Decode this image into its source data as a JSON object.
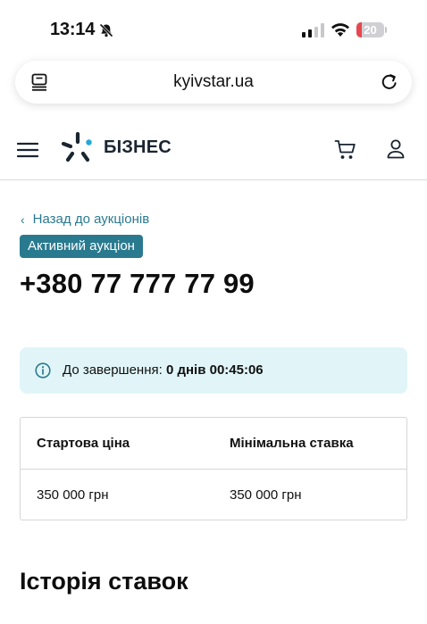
{
  "status_bar": {
    "time": "13:14",
    "battery_level": "20",
    "battery_fraction": 0.2,
    "icons": [
      "bell-slash-icon",
      "signal-icon",
      "wifi-icon",
      "battery-icon"
    ]
  },
  "browser": {
    "url": "kyivstar.ua",
    "icons": [
      "tabs-icon",
      "reload-icon"
    ]
  },
  "header": {
    "logo_text": "БІЗНЕС",
    "icons": [
      "menu-icon",
      "kyivstar-star-logo",
      "cart-icon",
      "user-icon"
    ]
  },
  "page": {
    "back_link": "Назад до аукціонів",
    "status_badge": "Активний аукціон",
    "phone_number": "+380 77 777 77 99",
    "timer": {
      "label": "До завершення:",
      "value": "0 днів 00:45:06"
    },
    "table": {
      "headers": [
        "Стартова ціна",
        "Мінімальна ставка"
      ],
      "row": [
        "350 000 грн",
        "350 000 грн"
      ]
    },
    "history_title": "Історія ставок"
  },
  "colors": {
    "accent": "#2a7a8f",
    "timer_bg": "#e1f5f8",
    "battery_low": "#e5484d",
    "logo_dot": "#1fa9d6"
  }
}
